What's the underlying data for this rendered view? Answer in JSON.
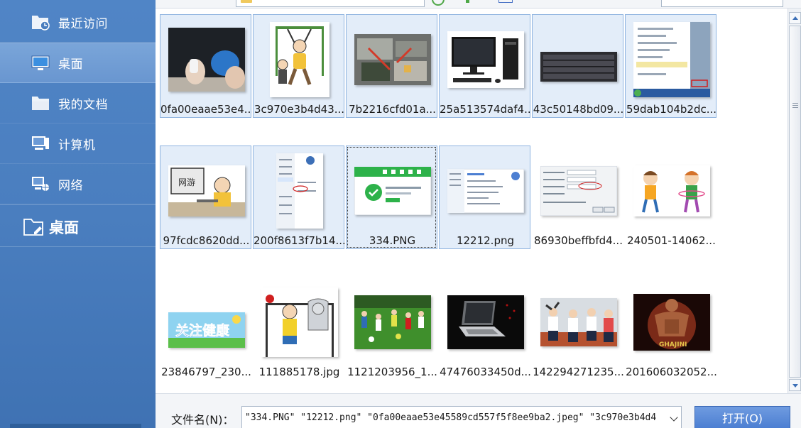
{
  "sidebar": {
    "items": [
      {
        "label": "最近访问",
        "icon": "recent-folder-icon"
      },
      {
        "label": "桌面",
        "icon": "desktop-icon",
        "selected": true
      },
      {
        "label": "我的文档",
        "icon": "documents-folder-icon"
      },
      {
        "label": "计算机",
        "icon": "computer-icon"
      },
      {
        "label": "网络",
        "icon": "network-icon"
      }
    ],
    "section": {
      "label": "桌面",
      "icon": "desktop-folder-icon"
    }
  },
  "files": [
    {
      "name": "0fa00eaae53e4...",
      "thumb": "cleaning-screen",
      "selected": true
    },
    {
      "name": "3c970e3b4d43...",
      "thumb": "cartoon-pullup",
      "selected": true
    },
    {
      "name": "7b2216cfd01a...",
      "thumb": "pc-internals",
      "selected": true
    },
    {
      "name": "25a513574daf4...",
      "thumb": "desktop-pc",
      "selected": true
    },
    {
      "name": "43c50148bd09...",
      "thumb": "keyboard",
      "selected": true
    },
    {
      "name": "59dab104b2dc...",
      "thumb": "start-menu",
      "selected": true
    },
    {
      "name": "97fcdc8620dd...",
      "thumb": "cartoon-gamer",
      "selected": true
    },
    {
      "name": "200f8613f7b14...",
      "thumb": "context-menu",
      "selected": true
    },
    {
      "name": "334.PNG",
      "thumb": "app-window",
      "selected": true,
      "focused": true
    },
    {
      "name": "12212.png",
      "thumb": "sys-properties",
      "selected": true
    },
    {
      "name": "86930beffbfd4...",
      "thumb": "dialog-box",
      "selected": false
    },
    {
      "name": "240501-14062...",
      "thumb": "kids-skipping",
      "selected": false
    },
    {
      "name": "23846797_230...",
      "thumb": "banner",
      "selected": false
    },
    {
      "name": "111885178.jpg",
      "thumb": "cartoon-hanging",
      "selected": false
    },
    {
      "name": "1121203956_1...",
      "thumb": "kids-soccer",
      "selected": false
    },
    {
      "name": "47476033450d...",
      "thumb": "laptop",
      "selected": false
    },
    {
      "name": "142294271235...",
      "thumb": "exercise-group",
      "selected": false
    },
    {
      "name": "201606032052...",
      "thumb": "movie-poster",
      "selected": false
    }
  ],
  "thumb_text": {
    "gamer_sign": "网游",
    "banner": "关注健康",
    "poster": "GHAJINI"
  },
  "filename": {
    "label": "文件名(N)：",
    "value": "\"334.PNG\" \"12212.png\" \"0fa00eaae53e45589cd557f5f8ee9ba2.jpeg\" \"3c970e3b4d4"
  },
  "buttons": {
    "open": "打开(O)"
  },
  "colors": {
    "sidebar": "#4a7ebf",
    "selection": "#e3edf9",
    "accent": "#4c7fd2"
  }
}
